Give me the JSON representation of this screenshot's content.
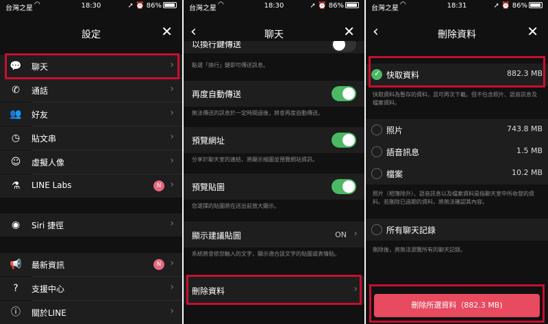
{
  "status": [
    {
      "carrier": "台灣之星",
      "time": "18:30",
      "battery": "86%"
    },
    {
      "carrier": "台灣之星",
      "time": "18:30",
      "battery": "86%"
    },
    {
      "carrier": "台灣之星",
      "time": "18:31",
      "battery": "86%"
    }
  ],
  "screen1": {
    "title": "設定",
    "items": [
      {
        "label": "聊天",
        "icon": "chat-bubble-icon"
      },
      {
        "label": "通話",
        "icon": "phone-icon"
      },
      {
        "label": "好友",
        "icon": "friends-icon"
      },
      {
        "label": "貼文串",
        "icon": "clock-icon"
      },
      {
        "label": "虛擬人像",
        "icon": "avatar-icon"
      },
      {
        "label": "LINE Labs",
        "icon": "flask-icon",
        "badge": "N"
      },
      {
        "label": "Siri 捷徑",
        "icon": "siri-icon"
      },
      {
        "label": "最新資訊",
        "icon": "megaphone-icon",
        "badge": "N"
      },
      {
        "label": "支援中心",
        "icon": "help-icon"
      },
      {
        "label": "關於LINE",
        "icon": "info-icon"
      }
    ]
  },
  "screen2": {
    "title": "聊天",
    "top_cut_label": "以換行鍵傳送",
    "top_desc": "點選「換行」鍵即可傳送訊息。",
    "rows": [
      {
        "label": "再度自動傳送",
        "desc": "無法傳送的訊息於一定時間過後，將會再度自動傳送。"
      },
      {
        "label": "預覽網址",
        "desc": "分享於聊天室的連結，將顯示縮圖並預覽網站資訊。"
      },
      {
        "label": "預覽貼圖",
        "desc": "您選擇的貼圖將在送出前放大顯示。"
      },
      {
        "label": "顯示建議貼圖",
        "value": "ON",
        "desc": "系統將會依您輸入的文字，顯示適合該文字的貼圖或表情貼。"
      },
      {
        "label": "刪除資料"
      }
    ]
  },
  "screen3": {
    "title": "刪除資料",
    "cache": {
      "label": "快取資料",
      "size": "882.3 MB",
      "desc": "快取資料為暫存的資料，且可再次下載。但不包含照片、語音訊息及檔案資料。"
    },
    "media": [
      {
        "label": "照片",
        "size": "743.8 MB"
      },
      {
        "label": "語音訊息",
        "size": "1.5 MB"
      },
      {
        "label": "檔案",
        "size": "10.2 MB"
      }
    ],
    "media_desc": "照片（相簿除外）、語音訊息以及檔案資料是指聊天室中所收發的資料。若刪除已過期的資料，將無法確認其內容。",
    "all_chats": {
      "label": "所有聊天記錄",
      "desc": "刪除後，將無法瀏覽所有的聊天記錄。"
    },
    "delete_button": "刪除所選資料（882.3 MB)",
    "colors": {
      "accent_green": "#4cb864",
      "delete_red": "#e84a5f",
      "highlight_red": "#c8102e"
    }
  }
}
